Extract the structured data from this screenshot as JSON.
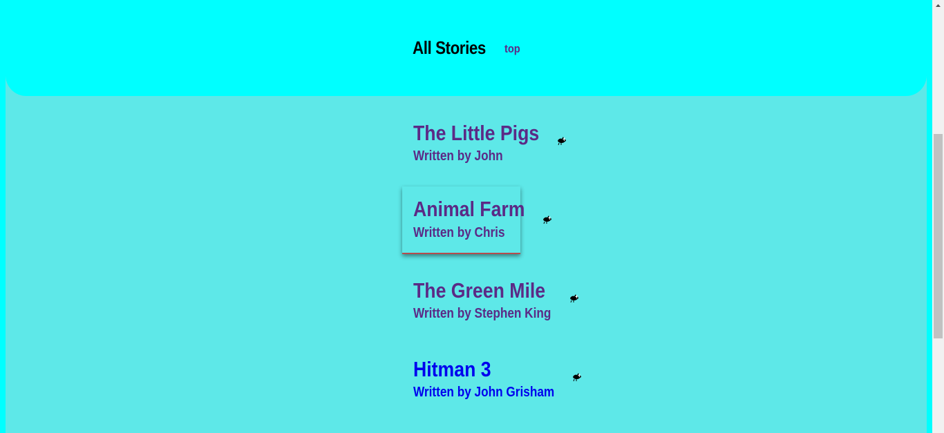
{
  "header": {
    "title": "All Stories",
    "top_link": "top"
  },
  "stories": [
    {
      "title": "The Little Pigs",
      "author": "Written by John",
      "icon": "bird-icon"
    },
    {
      "title": "Animal Farm",
      "author": "Written by Chris",
      "icon": "bird-icon"
    },
    {
      "title": "The Green Mile",
      "author": "Written by Stephen King",
      "icon": "bird-icon"
    },
    {
      "title": "Hitman 3",
      "author": "Written by John Grisham",
      "icon": "bird-icon"
    }
  ],
  "colors": {
    "header_bg": "#00ffff",
    "page_bg": "#5ee8e8",
    "story_text": "#5b2a86",
    "link_text": "#0000ee"
  }
}
